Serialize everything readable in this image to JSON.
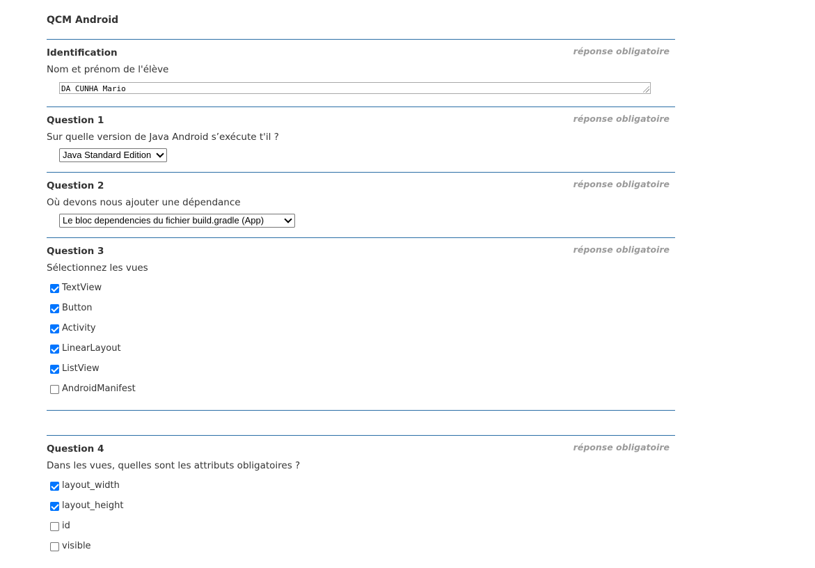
{
  "form": {
    "title": "QCM Android"
  },
  "sections": [
    {
      "title": "Identification",
      "required": "réponse obligatoire",
      "text": "Nom et prénom de l'élève",
      "value": "DA CUNHA Mario"
    },
    {
      "title": "Question 1",
      "required": "réponse obligatoire",
      "text": "Sur quelle version de Java Android s’exécute t'il ?",
      "selected": "Java Standard Edition"
    },
    {
      "title": "Question 2",
      "required": "réponse obligatoire",
      "text": "Où devons nous ajouter une dépendance",
      "selected": "Le bloc dependencies du fichier build.gradle (App)"
    },
    {
      "title": "Question 3",
      "required": "réponse obligatoire",
      "text": "Sélectionnez les vues",
      "options": [
        {
          "label": "TextView",
          "checked": true
        },
        {
          "label": "Button",
          "checked": true
        },
        {
          "label": "Activity",
          "checked": true
        },
        {
          "label": "LinearLayout",
          "checked": true
        },
        {
          "label": "ListView",
          "checked": true
        },
        {
          "label": "AndroidManifest",
          "checked": false
        }
      ]
    },
    {
      "title": "Question 4",
      "required": "réponse obligatoire",
      "text": "Dans les vues, quelles sont les attributs obligatoires ?",
      "options": [
        {
          "label": "layout_width",
          "checked": true
        },
        {
          "label": "layout_height",
          "checked": true
        },
        {
          "label": "id",
          "checked": false
        },
        {
          "label": "visible",
          "checked": false
        }
      ]
    }
  ],
  "colors": {
    "rule": "#2a6ea6",
    "required": "#9a9a9a",
    "checkbox": "#0075ff"
  }
}
